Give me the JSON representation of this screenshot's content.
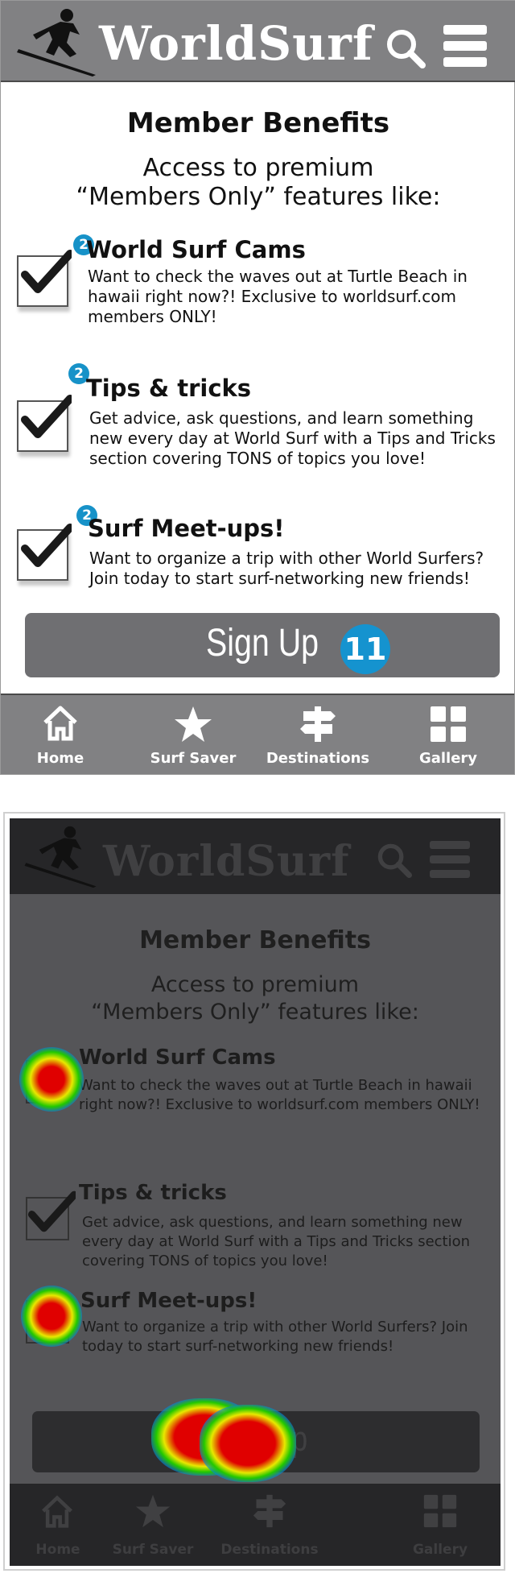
{
  "app": {
    "brand": "WorldSurf"
  },
  "header": {
    "search_icon": "search-icon",
    "menu_icon": "hamburger-menu-icon",
    "logo_icon": "surfer-logo-icon"
  },
  "main": {
    "title": "Member Benefits",
    "intro_line1": "Access to premium",
    "intro_line2": "“Members Only” features like:",
    "benefits": [
      {
        "title": "World Surf Cams",
        "desc": "Want to check the waves out at Turtle Beach in hawaii right now?! Exclusive to worldsurf.com members ONLY!",
        "checked": true,
        "badge": "2"
      },
      {
        "title": "Tips & tricks",
        "desc": "Get advice, ask questions, and learn something new every day at World Surf with a Tips and Tricks section covering TONS of topics you love!",
        "checked": true,
        "badge": "2"
      },
      {
        "title": "Surf Meet-ups!",
        "desc": "Want to organize a trip with other World Surfers? Join today to start surf-networking new friends!",
        "checked": true,
        "badge": "2"
      }
    ],
    "signup_label": "Sign Up",
    "signup_badge": "11"
  },
  "tabbar": {
    "items": [
      {
        "label": "Home",
        "icon": "home-icon"
      },
      {
        "label": "Surf Saver",
        "icon": "star-icon"
      },
      {
        "label": "Destinations",
        "icon": "signpost-icon"
      },
      {
        "label": "Gallery",
        "icon": "grid-icon"
      }
    ]
  },
  "colors": {
    "header_bg": "#818183",
    "badge_blue": "#1593cf",
    "signup_bg": "#6f6f72",
    "heat_red": "#e00000",
    "heat_yellow": "#e8e800",
    "heat_green": "#22c800"
  }
}
